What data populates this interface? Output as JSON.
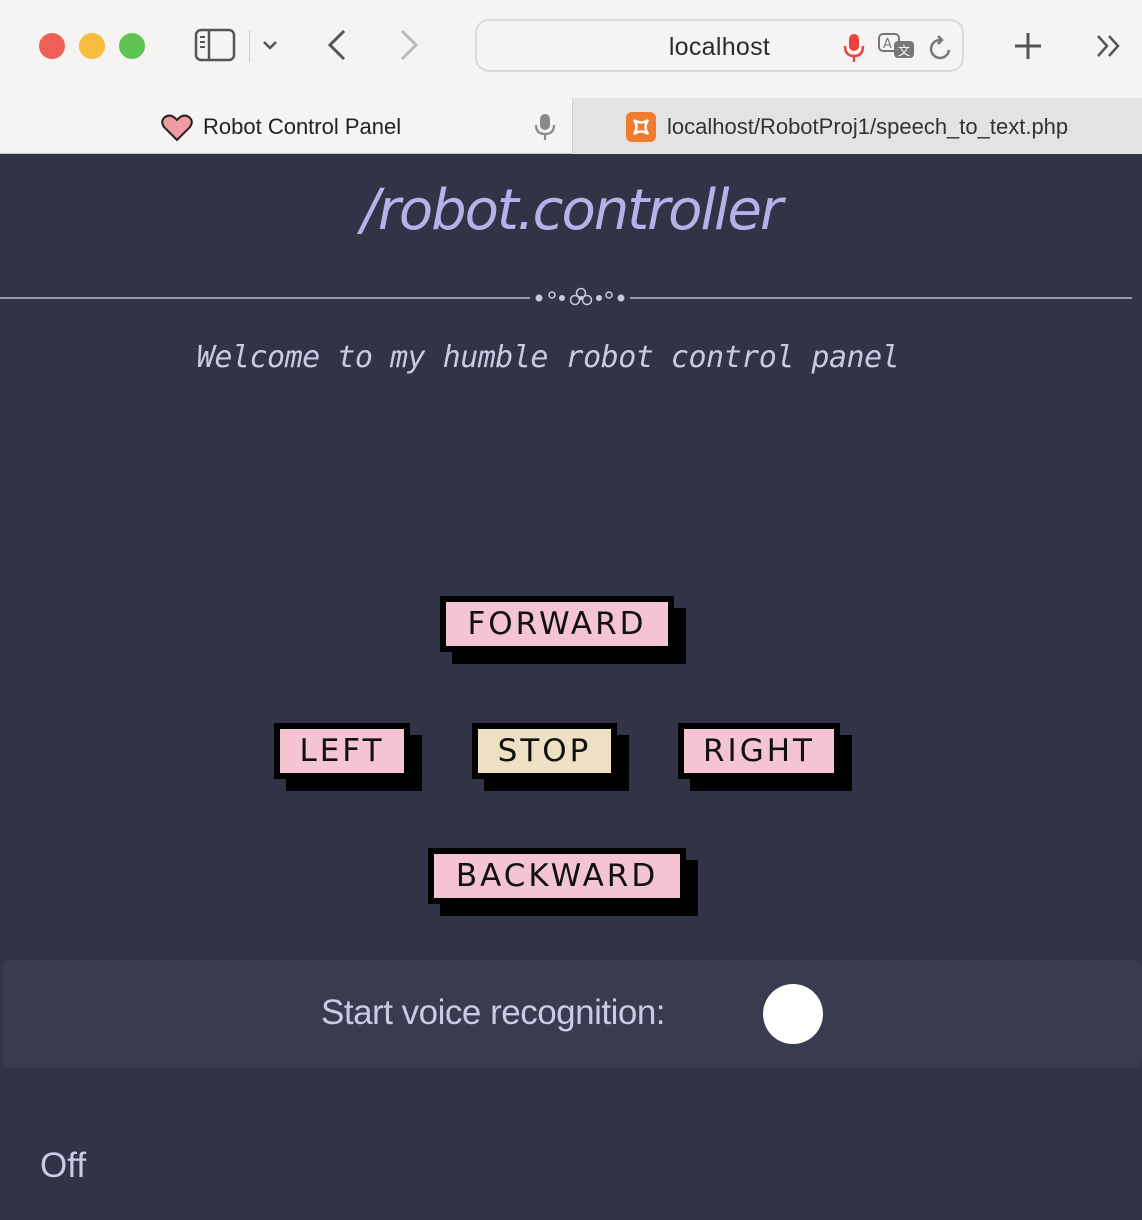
{
  "browser": {
    "url": "localhost",
    "tabs": [
      {
        "title": "Robot Control Panel",
        "active": true
      },
      {
        "title": "localhost/RobotProj1/speech_to_text.php",
        "active": false
      }
    ]
  },
  "page": {
    "title": "/robot.controller",
    "welcome": "Welcome to my humble robot control panel",
    "controls": {
      "forward": "FORWARD",
      "left": "LEFT",
      "stop": "STOP",
      "right": "RIGHT",
      "backward": "BACKWARD"
    },
    "voice": {
      "label": "Start voice recognition:",
      "status": "Off"
    }
  },
  "colors": {
    "background": "#313446",
    "title": "#b3b3ea",
    "button": "#f4c4d3",
    "stop_button": "#ede0c3",
    "panel": "#393c4f"
  }
}
